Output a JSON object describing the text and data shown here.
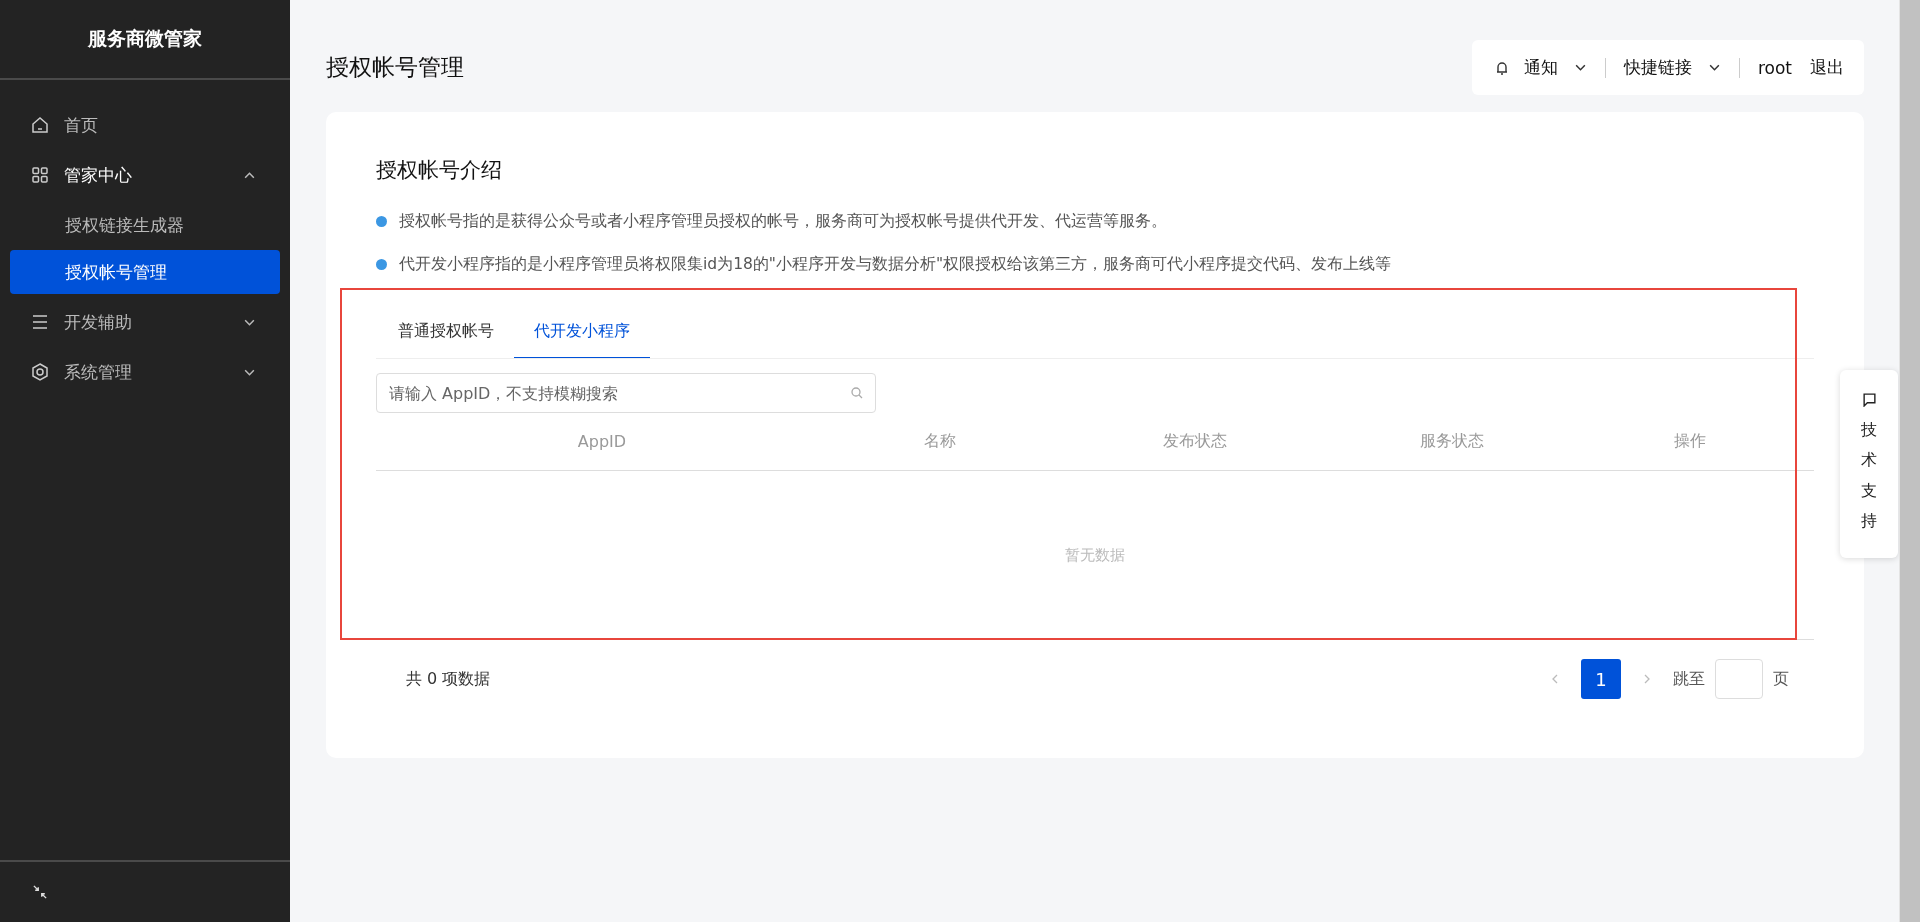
{
  "sidebar": {
    "brand": "服务商微管家",
    "items": [
      {
        "label": "首页",
        "selected": false
      },
      {
        "label": "管家中心",
        "expanded": true,
        "selected": false,
        "children": [
          {
            "label": "授权链接生成器",
            "selected": false
          },
          {
            "label": "授权帐号管理",
            "selected": true
          }
        ]
      },
      {
        "label": "开发辅助",
        "expanded": false,
        "selected": false
      },
      {
        "label": "系统管理",
        "expanded": false,
        "selected": false
      }
    ]
  },
  "page_title": "授权帐号管理",
  "header": {
    "notify": "通知",
    "shortcuts": "快捷链接",
    "user": "root",
    "logout": "退出"
  },
  "intro": {
    "title": "授权帐号介绍",
    "bullets": [
      "授权帐号指的是获得公众号或者小程序管理员授权的帐号，服务商可为授权帐号提供代开发、代运营等服务。",
      "代开发小程序指的是小程序管理员将权限集id为18的\"小程序开发与数据分析\"权限授权给该第三方，服务商可代小程序提交代码、发布上线等"
    ]
  },
  "tabs": [
    {
      "label": "普通授权帐号",
      "selected": false
    },
    {
      "label": "代开发小程序",
      "selected": true
    }
  ],
  "search": {
    "placeholder": "请输入 AppID，不支持模糊搜索"
  },
  "table": {
    "columns": [
      "AppID",
      "名称",
      "发布状态",
      "服务状态",
      "操作"
    ],
    "empty": "暂无数据"
  },
  "pagination": {
    "total": "共 0 项数据",
    "pages": [
      {
        "label": "1",
        "selected": true
      }
    ],
    "jump_label": "跳至",
    "page_unit": "页"
  },
  "support": {
    "label": "技术支持"
  }
}
